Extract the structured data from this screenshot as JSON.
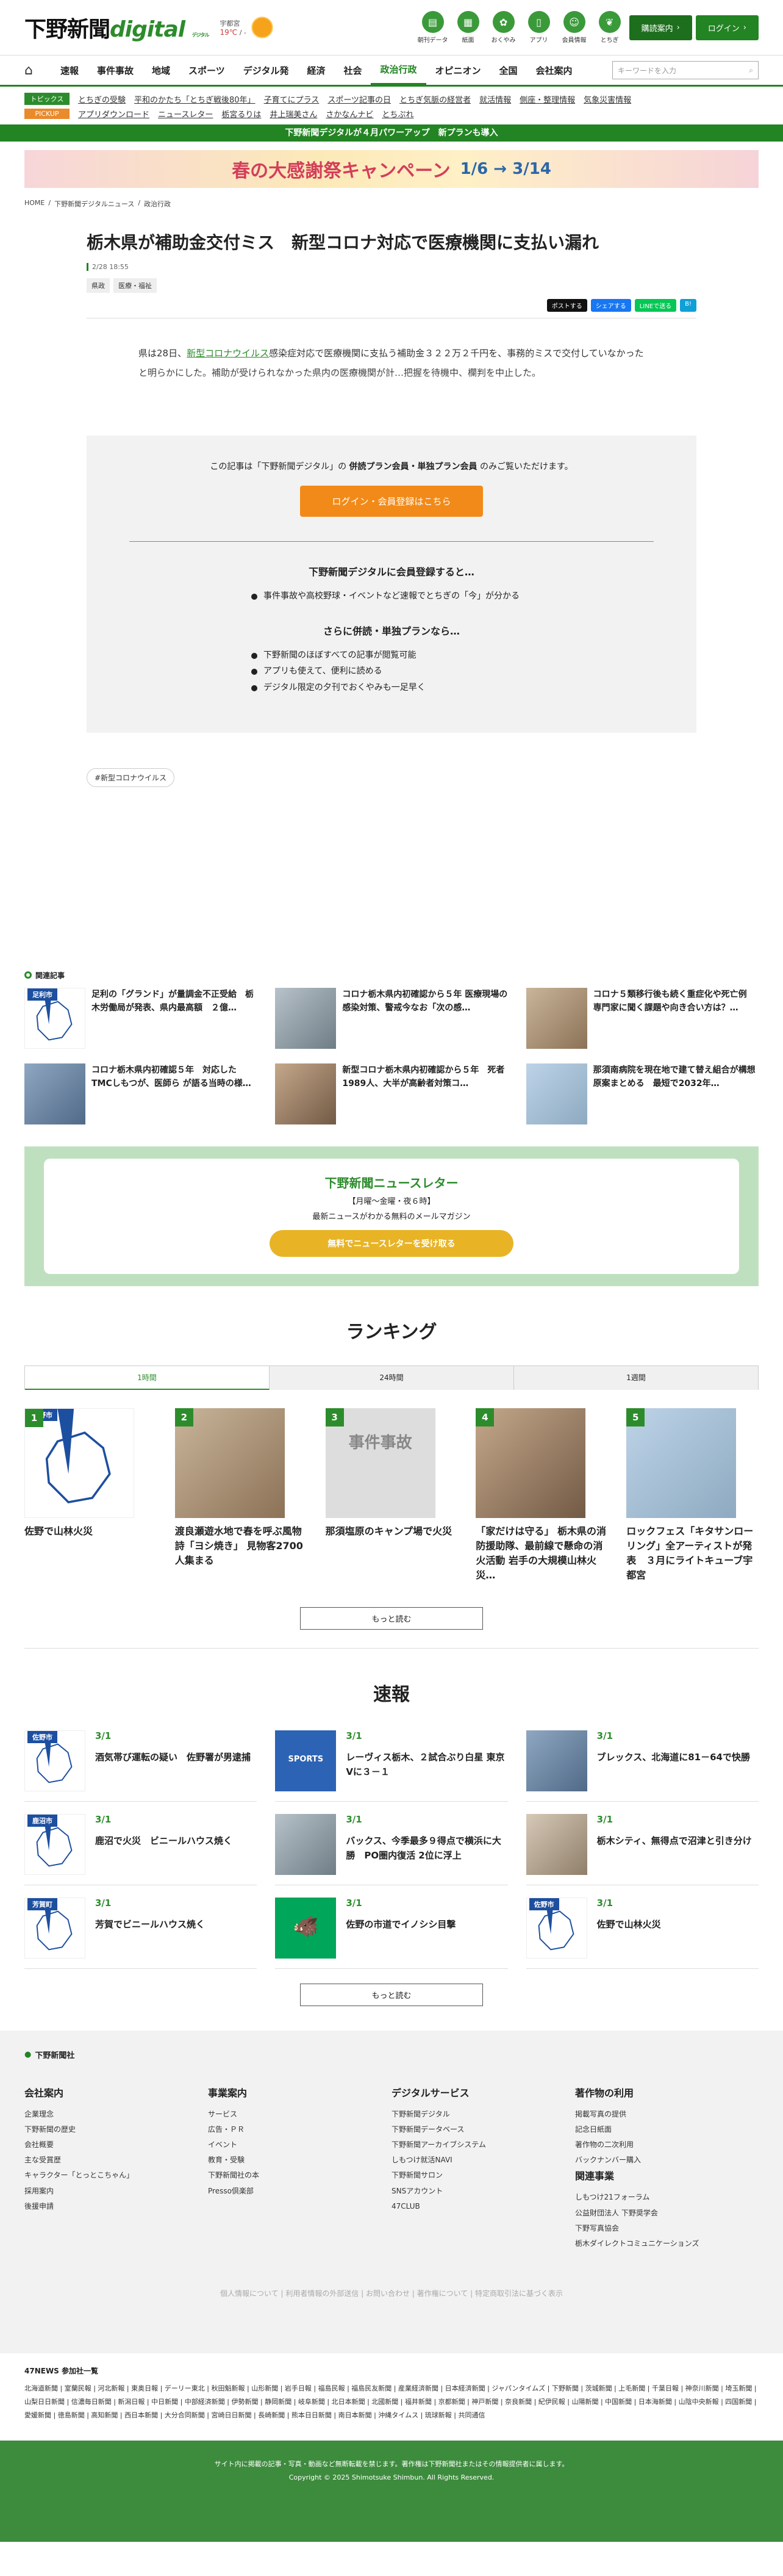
{
  "header": {
    "logo_main": "下野新聞",
    "logo_sub": "digital",
    "logo_small": "デジタル",
    "weather_city": "宇都宮",
    "weather_temp": "19℃",
    "weather_sep": "/ -",
    "icons": [
      {
        "label": "朝刊データ",
        "icon": "newspaper-icon"
      },
      {
        "label": "紙面",
        "icon": "paper-icon"
      },
      {
        "label": "おくやみ",
        "icon": "flower-icon"
      },
      {
        "label": "アプリ",
        "icon": "phone-icon"
      },
      {
        "label": "会員情報",
        "icon": "user-icon"
      },
      {
        "label": "とちぎ",
        "icon": "leaf-icon"
      }
    ],
    "subscribe_label": "購読案内",
    "login_label": "ログイン"
  },
  "nav": {
    "items": [
      "速報",
      "事件事故",
      "地域",
      "スポーツ",
      "デジタル発",
      "経済",
      "社会",
      "政治行政",
      "オピニオン",
      "全国",
      "会社案内"
    ],
    "active": "政治行政",
    "search_placeholder": "キーワードを入力"
  },
  "topics": {
    "label1": "トピックス",
    "links1": [
      "とちぎの受験",
      "平和のかたち「とちぎ戦後80年」",
      "子育てにプラス",
      "スポーツ記事の日",
      "とちぎ気脈の経営者",
      "就活情報",
      "側座・整理情報",
      "気象災害情報"
    ],
    "label2": "PICKUP",
    "links2": [
      "アプリダウンロード",
      "ニュースレター",
      "栃宮るりは",
      "井上瑞美さん",
      "さかなんナビ",
      "とちぷれ"
    ],
    "strip": "下野新聞デジタルが４月パワーアップ　新プランも導入"
  },
  "promo": {
    "main": "春の大感謝祭キャンペーン",
    "date": "1/6 → 3/14"
  },
  "breadcrumb": [
    "HOME",
    "下野新聞デジタルニュース",
    "政治行政"
  ],
  "article": {
    "title": "栃木県が補助金交付ミス　新型コロナ対応で医療機関に支払い漏れ",
    "date": "2/28 18:55",
    "tags": [
      "県政",
      "医療・福祉"
    ],
    "share": [
      "ポストする",
      "シェアする",
      "LINEで送る",
      "B!"
    ],
    "lead_pre": "県は28日、",
    "lead_link": "新型コロナウイルス",
    "lead_post": "感染症対応で医療機関に支払う補助金３２２万２千円を、事務的ミスで交付していなかったと明らかにした。補助が受けられなかった県内の医療機関が計…把握を待機中、欄判を中止した。"
  },
  "paywall": {
    "notice_pre": "この記事は「下野新聞デジタル」の ",
    "notice_bold": "併読プラン会員・単独プラン会員",
    "notice_post": " のみご覧いただけます。",
    "login_btn": "ログイン・会員登録はこちら",
    "h1": "下野新聞デジタルに会員登録すると…",
    "list1": [
      "事件事故や高校野球・イベントなど速報でとちぎの「今」が分かる"
    ],
    "h2": "さらに併読・単独プランなら…",
    "list2": [
      "下野新聞のほぼすべての記事が閲覧可能",
      "アプリも使えて、便利に読める",
      "デジタル限定の夕刊でおくやみも一足早く"
    ]
  },
  "keyword": "#新型コロナウイルス",
  "related": {
    "heading": "関連記事",
    "items": [
      {
        "title": "足利の「グランド」が量調金不正受給　栃木労働局が発表、県内最高額　２億…",
        "thumb": "map",
        "label": "足利市"
      },
      {
        "title": "コロナ栃木県内初確認から５年 医療現場の感染対策、警戒今なお「次の感…",
        "thumb": "photo1"
      },
      {
        "title": "コロナ５類移行後も続く重症化や死亡例　専門家に聞く課題や向き合い方は？…",
        "thumb": "photo2"
      },
      {
        "title": "コロナ栃木県内初確認５年　対応したTMCしもつが、医師ら が語る当時の様…",
        "thumb": "photo3"
      },
      {
        "title": "新型コロナ栃木県内初確認から５年　死者1989人、大半が高齢者対策コ…",
        "thumb": "photo4"
      },
      {
        "title": "那須南病院を現在地で建て替え組合が構想原案まとめる　最短で2032年…",
        "thumb": "photo6"
      }
    ]
  },
  "newsletter": {
    "title": "下野新聞ニュースレター",
    "sub1": "【月曜～金曜・夜６時】",
    "sub2": "最新ニュースがわかる無料のメールマガジン",
    "btn": "無料でニュースレターを受け取る"
  },
  "ranking": {
    "heading": "ランキング",
    "tabs": [
      "1時間",
      "24時間",
      "1週間"
    ],
    "items": [
      {
        "num": "1",
        "title": "佐野で山林火災",
        "thumb": "map",
        "label": "佐野市"
      },
      {
        "num": "2",
        "title": "渡良瀬遊水地で春を呼ぶ風物詩「ヨシ焼き」 見物客2700人集まる",
        "thumb": "photo2"
      },
      {
        "num": "3",
        "title": "那須塩原のキャンプ場で火災",
        "thumb": "jiko",
        "label": "事件事故"
      },
      {
        "num": "4",
        "title": "「家だけは守る」 栃木県の消防援助隊、最前線で懸命の消火活動 岩手の大規模山林火災…",
        "thumb": "photo4"
      },
      {
        "num": "5",
        "title": "ロックフェス「キタサンローリング」全アーティストが発表　３月にライトキューブ宇都宮",
        "thumb": "photo6"
      }
    ],
    "more": "もっと読む"
  },
  "sokuho": {
    "heading": "速報",
    "items": [
      {
        "date": "3/1",
        "title": "酒気帯び運転の疑い　佐野署が男逮捕",
        "thumb": "map",
        "label": "佐野市"
      },
      {
        "date": "3/1",
        "title": "レーヴィス栃木、２試合ぶり白星 東京Vに３－１",
        "thumb": "sports",
        "label": "SPORTS"
      },
      {
        "date": "3/1",
        "title": "ブレックス、北海道に81－64で快勝",
        "thumb": "photo3"
      },
      {
        "date": "3/1",
        "title": "鹿沼で火災　ビニールハウス焼く",
        "thumb": "map",
        "label": "鹿沼市"
      },
      {
        "date": "3/1",
        "title": "バックス、今季最多９得点で横浜に大勝　PO圏内復活 2位に浮上",
        "thumb": "photo1"
      },
      {
        "date": "3/1",
        "title": "栃木シティ、無得点で沼津と引き分け",
        "thumb": "photo5"
      },
      {
        "date": "3/1",
        "title": "芳賀でビニールハウス焼く",
        "thumb": "map",
        "label": "芳賀町"
      },
      {
        "date": "3/1",
        "title": "佐野の市道でイノシシ目撃",
        "thumb": "boar"
      },
      {
        "date": "3/1",
        "title": "佐野で山林火災",
        "thumb": "map",
        "label": "佐野市"
      }
    ],
    "more": "もっと読む"
  },
  "footer": {
    "logo": "下野新聞社",
    "cols": [
      {
        "h": "会社案内",
        "items": [
          "企業理念",
          "下野新聞の歴史",
          "会社概要",
          "主な受賞歴",
          "キャラクター「とっとこちゃん」",
          "採用案内",
          "後援申請"
        ]
      },
      {
        "h": "事業案内",
        "items": [
          "サービス",
          "広告・ＰＲ",
          "イベント",
          "教育・受験",
          "下野新聞社の本",
          "Presso倶楽部"
        ]
      },
      {
        "h": "デジタルサービス",
        "items": [
          "下野新聞デジタル",
          "下野新聞データベース",
          "下野新聞アーカイブシステム",
          "しもつけ就活NAVI",
          "下野新聞サロン",
          "SNSアカウント",
          "47CLUB"
        ]
      },
      {
        "h": "著作物の利用",
        "items": [
          "掲載写真の提供",
          "記念日紙面",
          "著作物の二次利用",
          "バックナンバー購入"
        ]
      }
    ],
    "related_h": "関連事業",
    "related_items": [
      "しもつけ21フォーラム",
      "公益財団法人 下野奨学会",
      "下野写真協会",
      "栃木ダイレクトコミュニケーションズ"
    ],
    "links": "個人情報について | 利用者情報の外部送信 | お問い合わせ | 著作権について | 特定商取引法に基づく表示",
    "news47_h": "47NEWS 参加社一覧",
    "news47": "北海道新聞 | 室蘭民報 | 河北新報 | 東奥日報 | デーリー東北 | 秋田魁新報 | 山形新聞 | 岩手日報 | 福島民報 | 福島民友新聞 | 産業経済新聞 | 日本経済新聞 | ジャパンタイムズ | 下野新聞 | 茨城新聞 | 上毛新聞 | 千葉日報 | 神奈川新聞 | 埼玉新聞 | 山梨日日新聞 | 信濃毎日新聞 | 新潟日報 | 中日新聞 | 中部経済新聞 | 伊勢新聞 | 静岡新聞 | 岐阜新聞 | 北日本新聞 | 北國新聞 | 福井新聞 | 京都新聞 | 神戸新聞 | 奈良新聞 | 紀伊民報 | 山陽新聞 | 中国新聞 | 日本海新聞 | 山陰中央新報 | 四国新聞 | 愛媛新聞 | 徳島新聞 | 高知新聞 | 西日本新聞 | 大分合同新聞 | 宮崎日日新聞 | 長崎新聞 | 熊本日日新聞 | 南日本新聞 | 沖縄タイムス | 琉球新報 | 共同通信",
    "copy1": "サイト内に掲載の記事・写真・動画など無断転載を禁じます。著作権は下野新聞社またはその情報提供者に属します。",
    "copy2": "Copyright © 2025 Shimotsuke Shimbun. All Rights Reserved."
  }
}
